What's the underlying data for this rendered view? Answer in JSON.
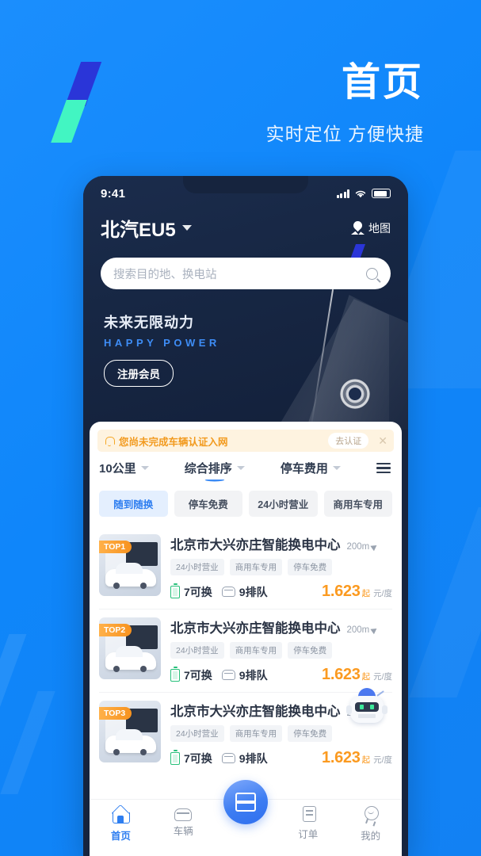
{
  "headline": {
    "title": "首页",
    "subtitle": "实时定位 方便快捷"
  },
  "status_bar": {
    "clock": "9:41",
    "signal_icon": "signal-bars-icon",
    "wifi_icon": "wifi-icon",
    "battery_icon": "battery-icon"
  },
  "app_header": {
    "vehicle_name": "北汽EU5",
    "dropdown_icon": "chevron-down-icon",
    "map_label": "地图",
    "map_icon": "map-pin-icon"
  },
  "search": {
    "placeholder": "搜索目的地、换电站",
    "icon": "search-icon"
  },
  "promo": {
    "cn_title": "未来无限动力",
    "en_title": "HAPPY POWER",
    "cta_label": "注册会员",
    "brand_logo": "shutter-logo-icon"
  },
  "alert": {
    "icon": "bell-icon",
    "message": "您尚未完成车辆认证入网",
    "action_label": "去认证",
    "close_icon": "close-icon",
    "bg_color": "#FEF3E0",
    "text_color": "#F29A1E"
  },
  "filters": [
    {
      "label": "10公里",
      "icon": "caret-down-icon",
      "active": false
    },
    {
      "label": "综合排序",
      "icon": "caret-down-icon",
      "active": true
    },
    {
      "label": "停车费用",
      "icon": "caret-down-icon",
      "active": false
    }
  ],
  "menu_icon": "hamburger-menu-icon",
  "chips": [
    {
      "label": "随到随换",
      "active": true
    },
    {
      "label": "停车免费",
      "active": false
    },
    {
      "label": "24小时营业",
      "active": false
    },
    {
      "label": "商用车专用",
      "active": false
    }
  ],
  "stations": [
    {
      "rank_badge": "TOP1",
      "name": "北京市大兴亦庄智能换电中心",
      "distance": "200m",
      "tags": [
        "24小时营业",
        "商用车专用",
        "停车免费"
      ],
      "available": "7可换",
      "queue": "9排队",
      "price": "1.623",
      "price_prefix": "起",
      "price_unit": "元/度"
    },
    {
      "rank_badge": "TOP2",
      "name": "北京市大兴亦庄智能换电中心",
      "distance": "200m",
      "tags": [
        "24小时营业",
        "商用车专用",
        "停车免费"
      ],
      "available": "7可换",
      "queue": "9排队",
      "price": "1.623",
      "price_prefix": "起",
      "price_unit": "元/度"
    },
    {
      "rank_badge": "TOP3",
      "name": "北京市大兴亦庄智能换电中心",
      "distance": "200m",
      "tags": [
        "24小时营业",
        "商用车专用",
        "停车免费"
      ],
      "available": "7可换",
      "queue": "9排队",
      "price": "1.623",
      "price_prefix": "起",
      "price_unit": "元/度"
    }
  ],
  "assistant": {
    "icon": "robot-assistant-icon"
  },
  "tabbar": {
    "items": [
      {
        "label": "首页",
        "icon": "home-icon",
        "active": true
      },
      {
        "label": "车辆",
        "icon": "car-icon",
        "active": false
      },
      {
        "label": "订单",
        "icon": "order-document-icon",
        "active": false
      },
      {
        "label": "我的",
        "icon": "user-profile-icon",
        "active": false
      }
    ],
    "fab_icon": "battery-swap-icon"
  },
  "colors": {
    "brand_blue": "#1289FB",
    "accent_orange": "#FB9A20",
    "tab_active": "#2E7EF0",
    "dark_navy": "#16243E"
  }
}
